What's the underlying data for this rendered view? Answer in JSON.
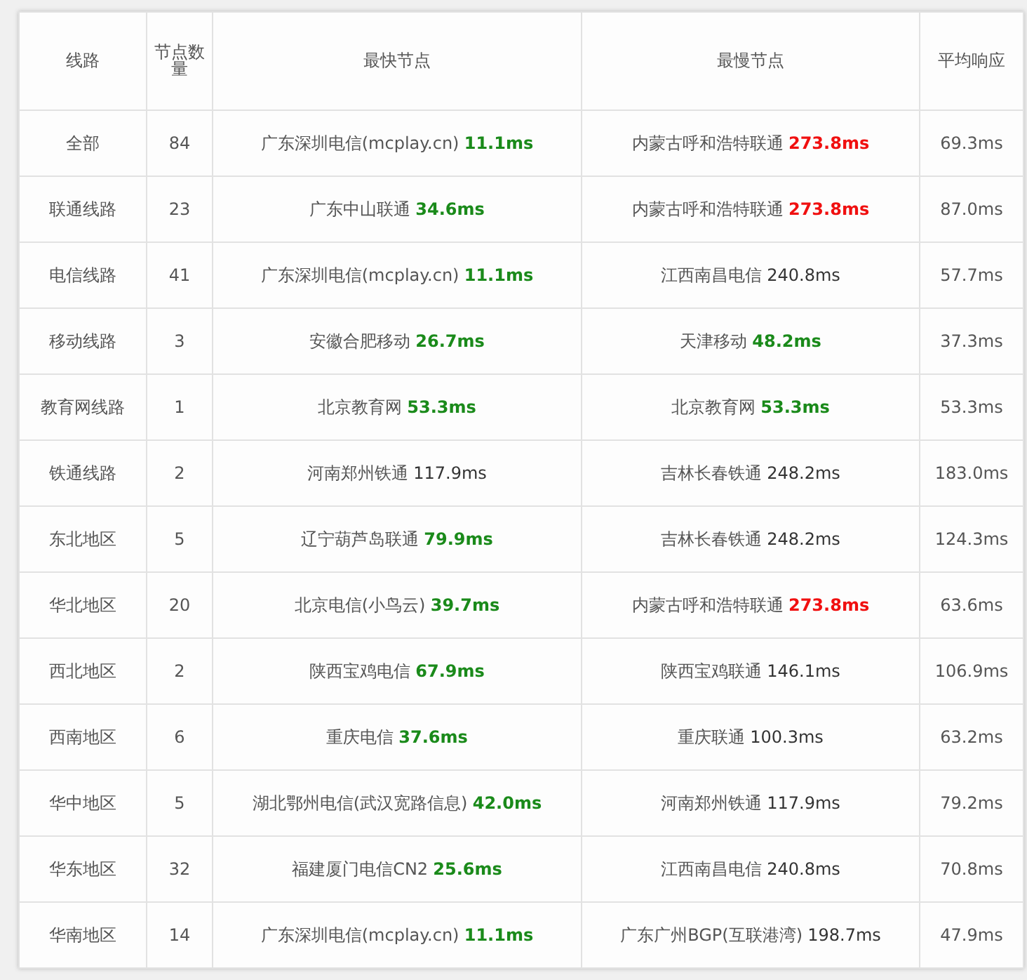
{
  "table": {
    "columns": [
      "线路",
      "节点数量",
      "最快节点",
      "最慢节点",
      "平均响应"
    ],
    "rows": [
      {
        "line": "全部",
        "count": "84",
        "fastest": {
          "node": "广东深圳电信(mcplay.cn)",
          "time": "11.1ms",
          "kind": "fast"
        },
        "slowest": {
          "node": "内蒙古呼和浩特联通",
          "time": "273.8ms",
          "kind": "slow"
        },
        "average": "69.3ms"
      },
      {
        "line": "联通线路",
        "count": "23",
        "fastest": {
          "node": "广东中山联通",
          "time": "34.6ms",
          "kind": "fast"
        },
        "slowest": {
          "node": "内蒙古呼和浩特联通",
          "time": "273.8ms",
          "kind": "slow"
        },
        "average": "87.0ms"
      },
      {
        "line": "电信线路",
        "count": "41",
        "fastest": {
          "node": "广东深圳电信(mcplay.cn)",
          "time": "11.1ms",
          "kind": "fast"
        },
        "slowest": {
          "node": "江西南昌电信",
          "time": "240.8ms",
          "kind": "normal"
        },
        "average": "57.7ms"
      },
      {
        "line": "移动线路",
        "count": "3",
        "fastest": {
          "node": "安徽合肥移动",
          "time": "26.7ms",
          "kind": "fast"
        },
        "slowest": {
          "node": "天津移动",
          "time": "48.2ms",
          "kind": "fast"
        },
        "average": "37.3ms"
      },
      {
        "line": "教育网线路",
        "count": "1",
        "fastest": {
          "node": "北京教育网",
          "time": "53.3ms",
          "kind": "fast"
        },
        "slowest": {
          "node": "北京教育网",
          "time": "53.3ms",
          "kind": "fast"
        },
        "average": "53.3ms"
      },
      {
        "line": "铁通线路",
        "count": "2",
        "fastest": {
          "node": "河南郑州铁通",
          "time": "117.9ms",
          "kind": "normal"
        },
        "slowest": {
          "node": "吉林长春铁通",
          "time": "248.2ms",
          "kind": "normal"
        },
        "average": "183.0ms"
      },
      {
        "line": "东北地区",
        "count": "5",
        "fastest": {
          "node": "辽宁葫芦岛联通",
          "time": "79.9ms",
          "kind": "fast"
        },
        "slowest": {
          "node": "吉林长春铁通",
          "time": "248.2ms",
          "kind": "normal"
        },
        "average": "124.3ms"
      },
      {
        "line": "华北地区",
        "count": "20",
        "fastest": {
          "node": "北京电信(小鸟云)",
          "time": "39.7ms",
          "kind": "fast"
        },
        "slowest": {
          "node": "内蒙古呼和浩特联通",
          "time": "273.8ms",
          "kind": "slow"
        },
        "average": "63.6ms"
      },
      {
        "line": "西北地区",
        "count": "2",
        "fastest": {
          "node": "陕西宝鸡电信",
          "time": "67.9ms",
          "kind": "fast"
        },
        "slowest": {
          "node": "陕西宝鸡联通",
          "time": "146.1ms",
          "kind": "normal"
        },
        "average": "106.9ms"
      },
      {
        "line": "西南地区",
        "count": "6",
        "fastest": {
          "node": "重庆电信",
          "time": "37.6ms",
          "kind": "fast"
        },
        "slowest": {
          "node": "重庆联通",
          "time": "100.3ms",
          "kind": "normal"
        },
        "average": "63.2ms"
      },
      {
        "line": "华中地区",
        "count": "5",
        "fastest": {
          "node": "湖北鄂州电信(武汉宽路信息)",
          "time": "42.0ms",
          "kind": "fast"
        },
        "slowest": {
          "node": "河南郑州铁通",
          "time": "117.9ms",
          "kind": "normal"
        },
        "average": "79.2ms"
      },
      {
        "line": "华东地区",
        "count": "32",
        "fastest": {
          "node": "福建厦门电信CN2",
          "time": "25.6ms",
          "kind": "fast"
        },
        "slowest": {
          "node": "江西南昌电信",
          "time": "240.8ms",
          "kind": "normal"
        },
        "average": "70.8ms"
      },
      {
        "line": "华南地区",
        "count": "14",
        "fastest": {
          "node": "广东深圳电信(mcplay.cn)",
          "time": "11.1ms",
          "kind": "fast"
        },
        "slowest": {
          "node": "广东广州BGP(互联港湾)",
          "time": "198.7ms",
          "kind": "normal"
        },
        "average": "47.9ms"
      }
    ]
  }
}
